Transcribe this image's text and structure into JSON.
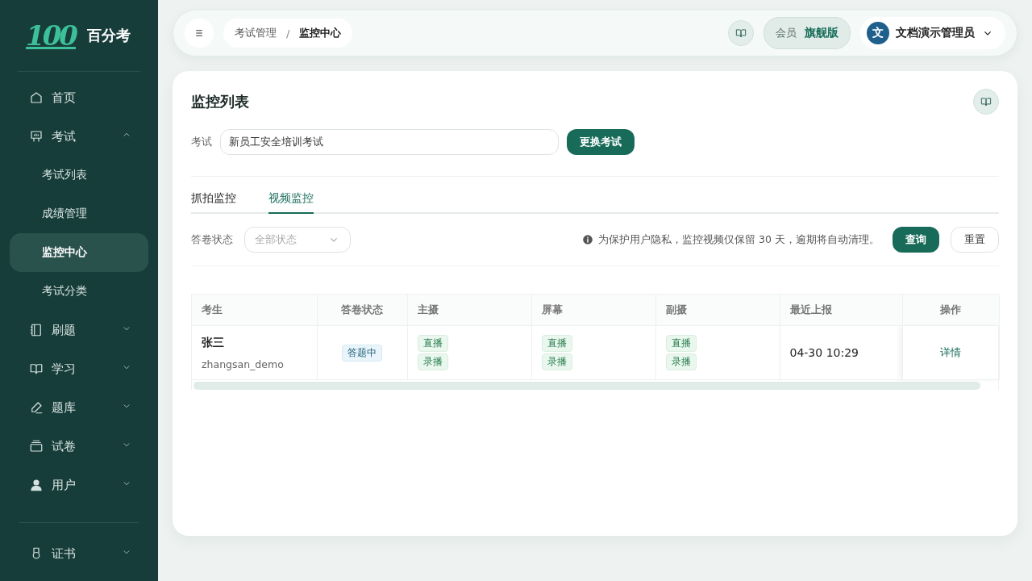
{
  "app": {
    "name": "百分考",
    "logo": "100"
  },
  "sidebar": {
    "items": [
      {
        "label": "首页",
        "selected": false
      },
      {
        "label": "考试",
        "expanded": true,
        "selected": false,
        "children": [
          {
            "label": "考试列表",
            "selected": false
          },
          {
            "label": "成绩管理",
            "selected": false
          },
          {
            "label": "监控中心",
            "selected": true
          },
          {
            "label": "考试分类",
            "selected": false
          }
        ]
      },
      {
        "label": "刷题",
        "expanded": false,
        "selected": false
      },
      {
        "label": "学习",
        "expanded": false,
        "selected": false
      },
      {
        "label": "题库",
        "expanded": false,
        "selected": false
      },
      {
        "label": "试卷",
        "expanded": false,
        "selected": false
      },
      {
        "label": "用户",
        "expanded": false,
        "selected": false
      }
    ],
    "footer_items": [
      {
        "label": "证书",
        "expanded": false,
        "selected": false
      }
    ]
  },
  "header": {
    "breadcrumb": [
      "考试管理",
      "监控中心"
    ],
    "breadcrumb_separator": "/",
    "membership": {
      "label": "会员",
      "tier": "旗舰版"
    },
    "user": {
      "avatar": "文",
      "name": "文档演示管理员"
    }
  },
  "card": {
    "title": "监控列表",
    "exam": {
      "label": "考试",
      "value": "新员工安全培训考试",
      "button": "更换考试"
    },
    "tabs": [
      {
        "label": "抓拍监控",
        "selected": false
      },
      {
        "label": "视频监控",
        "selected": true
      }
    ],
    "filter": {
      "label": "答卷状态",
      "placeholder": "全部状态"
    },
    "notice": "为保护用户隐私，监控视频仅保留 30 天，逾期将自动清理。",
    "buttons": [
      {
        "label": "查询",
        "kind": "primary"
      },
      {
        "label": "重置",
        "kind": "default"
      }
    ],
    "table": {
      "columns": [
        "考生",
        "答卷状态",
        "主摄",
        "屏幕",
        "副摄",
        "最近上报",
        "操作"
      ],
      "rows": [
        {
          "name": "张三",
          "username": "zhangsan_demo",
          "status": "答题中",
          "main": [
            "直播",
            "录播"
          ],
          "screen": [
            "直播",
            "录播"
          ],
          "secondary": [
            "直播",
            "录播"
          ],
          "last_report": "04-30 10:29",
          "action": "详情"
        }
      ]
    }
  }
}
